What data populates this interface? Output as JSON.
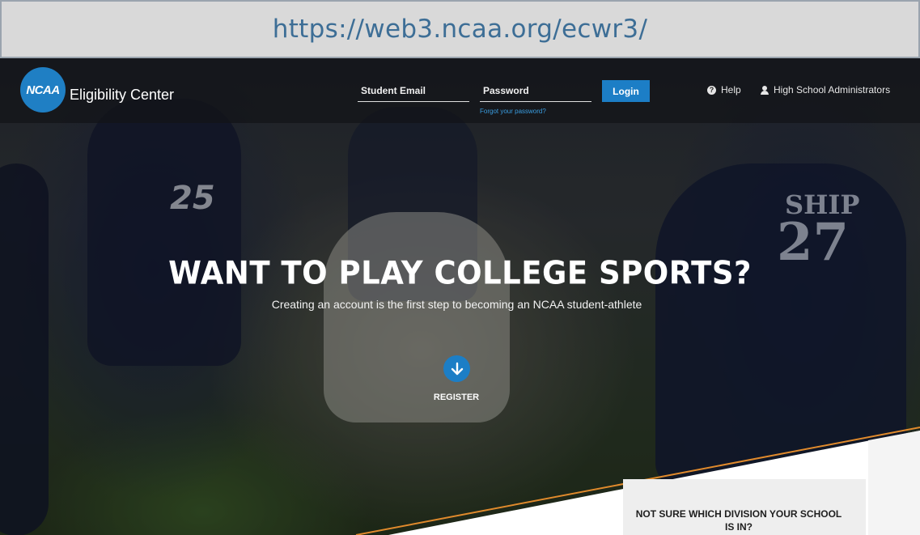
{
  "browser": {
    "url": "https://web3.ncaa.org/ecwr3/"
  },
  "nav": {
    "logo_text": "NCAA",
    "brand": "Eligibility Center",
    "email_placeholder": "Student Email",
    "password_placeholder": "Password",
    "forgot_password": "Forgot your password?",
    "login_label": "Login",
    "help_label": "Help",
    "admin_label": "High School Administrators"
  },
  "hero": {
    "headline": "WANT TO PLAY COLLEGE SPORTS?",
    "subline": "Creating an account is the first step to becoming an NCAA student-athlete",
    "register_label": "REGISTER",
    "jersey_left": "25",
    "jersey_right_name": "SHIP",
    "jersey_right_number": "27"
  },
  "panel": {
    "title": "NOT SURE WHICH DIVISION YOUR SCHOOL IS IN?"
  },
  "colors": {
    "accent": "#1c7ec6",
    "orange_line": "#e08a2c",
    "link": "#3a9de0"
  }
}
